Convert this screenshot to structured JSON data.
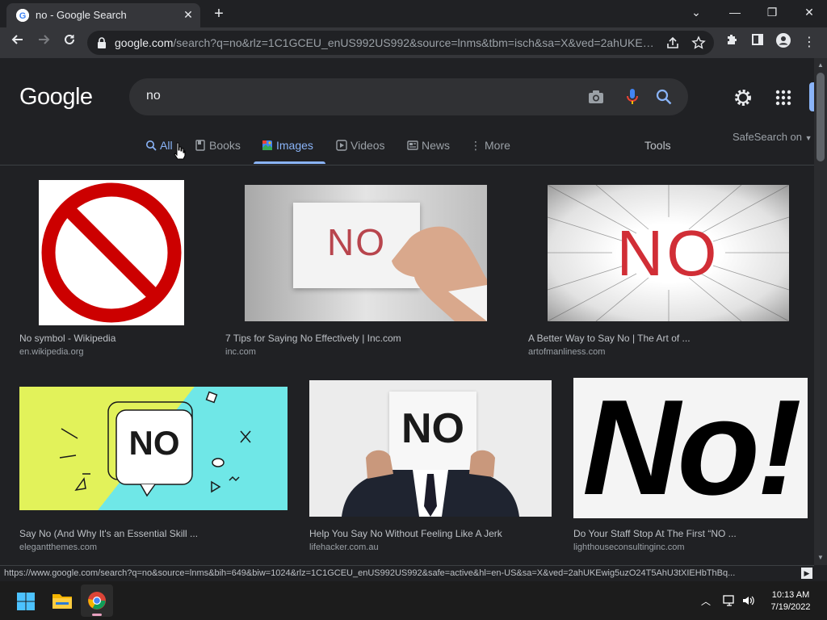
{
  "browser": {
    "tab_title": "no - Google Search",
    "url_host": "google.com",
    "url_rest": "/search?q=no&rlz=1C1GCEU_enUS992US992&source=lnms&tbm=isch&sa=X&ved=2ahUKEwj..."
  },
  "header": {
    "logo": "Google",
    "query": "no"
  },
  "tabs": [
    {
      "label": "All",
      "icon": "search-icon"
    },
    {
      "label": "Books",
      "icon": "book-icon"
    },
    {
      "label": "Images",
      "icon": "image-icon",
      "active": true
    },
    {
      "label": "Videos",
      "icon": "play-icon"
    },
    {
      "label": "News",
      "icon": "news-icon"
    },
    {
      "label": "More",
      "icon": "more-vert-icon"
    }
  ],
  "tools_label": "Tools",
  "safesearch_label": "SafeSearch on",
  "results": [
    {
      "title": "No symbol - Wikipedia",
      "site": "en.wikipedia.org"
    },
    {
      "title": "7 Tips for Saying No Effectively | Inc.com",
      "site": "inc.com",
      "image_text": "NO"
    },
    {
      "title": "A Better Way to Say No | The Art of ...",
      "site": "artofmanliness.com",
      "image_text": "NO"
    },
    {
      "title": "Say No (And Why It's an Essential Skill ...",
      "site": "elegantthemes.com",
      "image_text": "NO"
    },
    {
      "title": "Help You Say No Without Feeling Like A Jerk",
      "site": "lifehacker.com.au",
      "image_text": "NO"
    },
    {
      "title": "Do Your Staff Stop At The First “NO ...",
      "site": "lighthouseconsultinginc.com",
      "image_text": "No!"
    }
  ],
  "status_url": "https://www.google.com/search?q=no&source=lnms&bih=649&biw=1024&rlz=1C1GCEU_enUS992US992&safe=active&hl=en-US&sa=X&ved=2ahUKEwig5uzO24T5AhU3tXIEHbThBq...",
  "taskbar": {
    "time": "10:13 AM",
    "date": "7/19/2022"
  },
  "colors": {
    "accent": "#8ab4f8",
    "background": "#202124",
    "searchbox": "#303134"
  }
}
